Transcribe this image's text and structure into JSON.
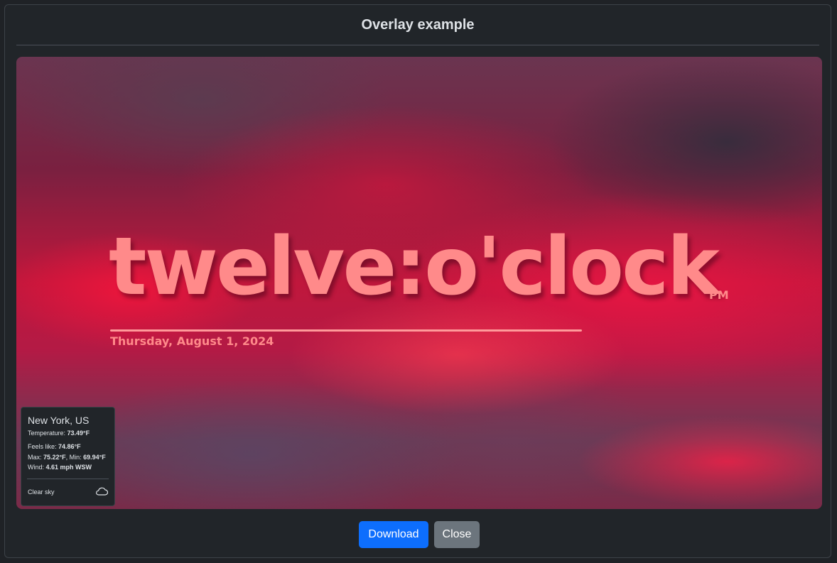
{
  "modal": {
    "title": "Overlay example"
  },
  "overlay": {
    "time_text": "twelve:o'clock",
    "ampm": "PM",
    "date": "Thursday, August 1, 2024"
  },
  "weather": {
    "location": "New York, US",
    "temperature_label": "Temperature: ",
    "temperature_value": "73.49°F",
    "feels_like_label": "Feels like: ",
    "feels_like_value": "74.86°F",
    "max_label": "Max: ",
    "max_value": "75.22°F",
    "min_label": ", Min: ",
    "min_value": "69.94°F",
    "wind_label": "Wind: ",
    "wind_value": "4.61 mph WSW",
    "condition": "Clear sky",
    "condition_icon": "cloud-icon"
  },
  "buttons": {
    "download": "Download",
    "close": "Close"
  },
  "colors": {
    "accent": "#0d6efd",
    "secondary": "#6c757d",
    "clock_text": "#ff8a8a",
    "modal_bg": "#212529"
  }
}
